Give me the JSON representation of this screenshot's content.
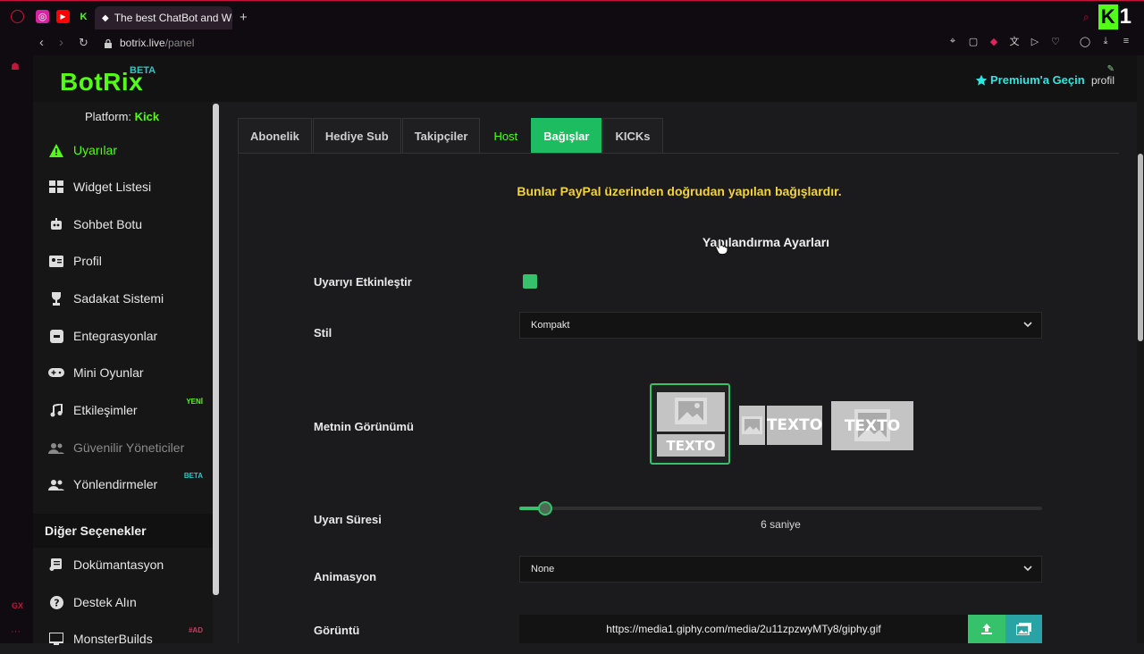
{
  "browser": {
    "tab_title": "The best ChatBot and Wid",
    "url_domain": "botrix.live",
    "url_path": "/panel",
    "sidebar_label": "GX"
  },
  "header": {
    "logo": "BotRix",
    "logo_badge": "BETA",
    "premium_label": "Premium'a Geçin",
    "profile_label": "profil"
  },
  "sidebar": {
    "platform_prefix": "Platform: ",
    "platform_name": "Kick",
    "items": [
      {
        "label": "Uyarılar",
        "icon": "warning-icon"
      },
      {
        "label": "Widget Listesi",
        "icon": "grid-icon"
      },
      {
        "label": "Sohbet Botu",
        "icon": "robot-icon"
      },
      {
        "label": "Profil",
        "icon": "id-card-icon"
      },
      {
        "label": "Sadakat Sistemi",
        "icon": "trophy-icon"
      },
      {
        "label": "Entegrasyonlar",
        "icon": "plug-icon"
      },
      {
        "label": "Mini Oyunlar",
        "icon": "gamepad-icon"
      },
      {
        "label": "Etkileşimler",
        "icon": "music-icon",
        "badge": "YENİ"
      },
      {
        "label": "Güvenilir Yöneticiler",
        "icon": "users-icon"
      },
      {
        "label": "Yönlendirmeler",
        "icon": "users-icon",
        "badge": "BETA"
      }
    ],
    "section_title": "Diğer Seçenekler",
    "other_items": [
      {
        "label": "Dokümantasyon",
        "icon": "scroll-icon"
      },
      {
        "label": "Destek Alın",
        "icon": "question-icon"
      },
      {
        "label": "MonsterBuilds",
        "icon": "monitor-icon",
        "badge": "#AD"
      }
    ]
  },
  "tabs": [
    {
      "label": "Abonelik"
    },
    {
      "label": "Hediye Sub"
    },
    {
      "label": "Takipçiler"
    },
    {
      "label": "Host"
    },
    {
      "label": "Bağışlar"
    },
    {
      "label": "KICKs"
    }
  ],
  "active_tab": "Bağışlar",
  "panel": {
    "notice": "Bunlar PayPal üzerinden doğrudan yapılan bağışlardır.",
    "config_title": "Yapılandırma Ayarları",
    "fields": {
      "enable_label": "Uyarıyı Etkinleştir",
      "enable_checked": true,
      "style_label": "Stil",
      "style_value": "Kompakt",
      "text_view_label": "Metnin Görünümü",
      "text_view_sample": "TEXTO",
      "duration_label": "Uyarı Süresi",
      "duration_value": "6 saniye",
      "duration_fraction": 0.04,
      "animation_label": "Animasyon",
      "animation_value": "None",
      "image_label": "Görüntü",
      "image_url": "https://media1.giphy.com/media/2u11zpzwyMTy8/giphy.gif"
    }
  },
  "colors": {
    "brand_green": "#53fc18",
    "accent_green": "#35c26b",
    "active_tab": "#1dbc60",
    "notice_yellow": "#f6d23a",
    "teal": "#2bc9c2"
  }
}
